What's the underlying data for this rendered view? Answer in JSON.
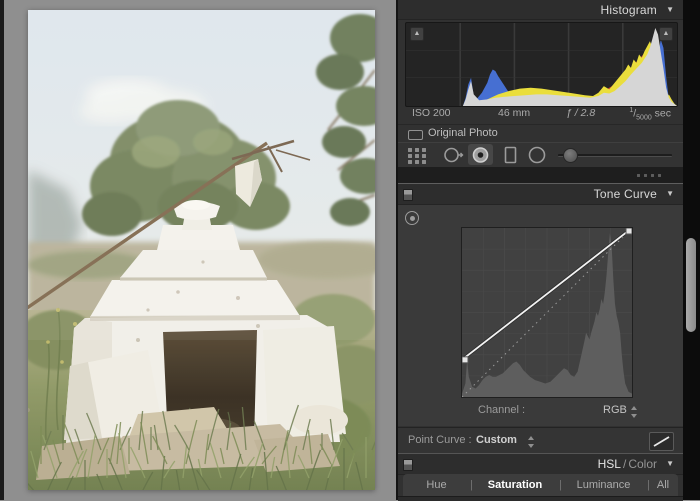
{
  "glyphs": {
    "collapse": "▼",
    "clip_warning": "▲"
  },
  "colors": {
    "hist_gray": "#d6d6d6",
    "hist_blue": "#466fd2",
    "hist_yellow": "#eade3c",
    "hist_red": "#ce4337",
    "hist_green": "#3da64c",
    "hist_magenta": "#bf3fae",
    "curve_silhouette": "#5e5e5e",
    "curve_line": "#f2f2f2",
    "curve_dotted": "#9b9b9b",
    "curve_grid": "#4a4a4a"
  },
  "histogram_panel": {
    "title": "Histogram",
    "meta": {
      "iso": "ISO 200",
      "focal_length": "46 mm",
      "aperture": "ƒ / 2.8",
      "shutter_numerator": "1",
      "shutter_denominator": "5000",
      "shutter_unit": "sec"
    },
    "original_photo_label": "Original Photo",
    "chart": {
      "type": "area",
      "x_range": [
        0,
        255
      ],
      "note_axis": "tonal value 0-100% width, height % of box",
      "series": [
        {
          "name": "magenta",
          "points": [
            [
              25,
              0
            ],
            [
              27,
              8
            ],
            [
              29,
              18
            ],
            [
              31,
              30
            ],
            [
              33,
              26
            ],
            [
              35,
              18
            ],
            [
              37,
              11
            ],
            [
              39,
              7
            ],
            [
              42,
              4
            ],
            [
              45,
              0
            ]
          ]
        },
        {
          "name": "green",
          "points": [
            [
              26,
              0
            ],
            [
              30,
              4
            ],
            [
              34,
              8
            ],
            [
              38,
              12
            ],
            [
              42,
              15
            ],
            [
              46,
              16
            ],
            [
              50,
              16
            ],
            [
              54,
              14
            ],
            [
              58,
              12
            ],
            [
              62,
              10
            ],
            [
              66,
              9
            ],
            [
              70,
              10
            ],
            [
              74,
              16
            ],
            [
              78,
              24
            ],
            [
              81,
              32
            ],
            [
              84,
              40
            ],
            [
              86,
              48
            ],
            [
              88,
              56
            ],
            [
              89,
              62
            ],
            [
              90,
              66
            ],
            [
              91,
              60
            ],
            [
              92,
              48
            ],
            [
              93,
              30
            ],
            [
              94,
              16
            ],
            [
              95,
              8
            ],
            [
              96,
              3
            ],
            [
              97,
              0
            ]
          ]
        },
        {
          "name": "red",
          "points": [
            [
              25,
              0
            ],
            [
              28,
              3
            ],
            [
              32,
              6
            ],
            [
              36,
              9
            ],
            [
              40,
              12
            ],
            [
              45,
              14
            ],
            [
              50,
              14
            ],
            [
              55,
              13
            ],
            [
              60,
              11
            ],
            [
              65,
              9
            ],
            [
              70,
              10
            ],
            [
              73,
              18
            ],
            [
              76,
              24
            ],
            [
              79,
              32
            ],
            [
              82,
              42
            ],
            [
              84,
              50
            ],
            [
              86,
              56
            ],
            [
              88,
              64
            ],
            [
              89,
              70
            ],
            [
              90,
              76
            ],
            [
              91,
              68
            ],
            [
              92,
              56
            ],
            [
              93,
              36
            ],
            [
              94,
              20
            ],
            [
              95,
              10
            ],
            [
              96,
              4
            ],
            [
              97,
              0
            ]
          ]
        },
        {
          "name": "blue",
          "points": [
            [
              21,
              0
            ],
            [
              22,
              10
            ],
            [
              23,
              26
            ],
            [
              24,
              34
            ],
            [
              25,
              12
            ],
            [
              26,
              8
            ],
            [
              28,
              16
            ],
            [
              30,
              28
            ],
            [
              31,
              38
            ],
            [
              32,
              44
            ],
            [
              33,
              42
            ],
            [
              34,
              36
            ],
            [
              36,
              26
            ],
            [
              38,
              16
            ],
            [
              40,
              10
            ],
            [
              43,
              8
            ],
            [
              48,
              7
            ],
            [
              55,
              6
            ],
            [
              62,
              5
            ],
            [
              70,
              6
            ],
            [
              76,
              8
            ],
            [
              80,
              12
            ],
            [
              84,
              16
            ],
            [
              87,
              22
            ],
            [
              89,
              30
            ],
            [
              90,
              40
            ],
            [
              91,
              50
            ],
            [
              92,
              55
            ],
            [
              93,
              60
            ],
            [
              94,
              80
            ],
            [
              95,
              70
            ],
            [
              96,
              35
            ],
            [
              97,
              8
            ],
            [
              98,
              0
            ]
          ]
        },
        {
          "name": "yellow",
          "points": [
            [
              24,
              0
            ],
            [
              26,
              4
            ],
            [
              30,
              8
            ],
            [
              34,
              14
            ],
            [
              38,
              18
            ],
            [
              42,
              21
            ],
            [
              46,
              22
            ],
            [
              50,
              21
            ],
            [
              54,
              19
            ],
            [
              58,
              17
            ],
            [
              62,
              15
            ],
            [
              66,
              13
            ],
            [
              69,
              12
            ],
            [
              71,
              16
            ],
            [
              73,
              24
            ],
            [
              75,
              20
            ],
            [
              77,
              28
            ],
            [
              79,
              36
            ],
            [
              81,
              44
            ],
            [
              82,
              50
            ],
            [
              83,
              46
            ],
            [
              84,
              56
            ],
            [
              85,
              52
            ],
            [
              86,
              62
            ],
            [
              87,
              58
            ],
            [
              88,
              66
            ],
            [
              89,
              72
            ],
            [
              90,
              78
            ],
            [
              91,
              70
            ],
            [
              92,
              58
            ],
            [
              93,
              38
            ],
            [
              94,
              22
            ],
            [
              95,
              12
            ],
            [
              96,
              8
            ],
            [
              97,
              14
            ],
            [
              98,
              8
            ],
            [
              99,
              3
            ],
            [
              100,
              0
            ]
          ]
        },
        {
          "name": "gray",
          "points": [
            [
              0,
              0
            ],
            [
              21,
              0
            ],
            [
              22,
              8
            ],
            [
              23,
              20
            ],
            [
              24,
              30
            ],
            [
              25,
              14
            ],
            [
              27,
              7
            ],
            [
              30,
              8
            ],
            [
              33,
              10
            ],
            [
              36,
              11
            ],
            [
              40,
              12
            ],
            [
              44,
              13
            ],
            [
              48,
              14
            ],
            [
              52,
              14
            ],
            [
              56,
              13
            ],
            [
              60,
              12
            ],
            [
              64,
              11
            ],
            [
              68,
              10
            ],
            [
              71,
              12
            ],
            [
              73,
              16
            ],
            [
              75,
              15
            ],
            [
              77,
              18
            ],
            [
              79,
              24
            ],
            [
              81,
              30
            ],
            [
              83,
              38
            ],
            [
              85,
              45
            ],
            [
              87,
              52
            ],
            [
              89,
              62
            ],
            [
              90,
              70
            ],
            [
              91,
              82
            ],
            [
              92,
              94
            ],
            [
              93,
              86
            ],
            [
              94,
              65
            ],
            [
              95,
              45
            ],
            [
              96,
              22
            ],
            [
              97,
              10
            ],
            [
              98,
              5
            ],
            [
              100,
              0
            ]
          ]
        }
      ]
    }
  },
  "toolstrip": {
    "tools": [
      "crop-overlay",
      "spot-removal",
      "red-eye-correction",
      "graduated-filter",
      "radial-filter"
    ],
    "active_tool": "red-eye-correction",
    "slider_position_pct": 4
  },
  "tone_curve_panel": {
    "title": "Tone Curve",
    "channel_label": "Channel :",
    "channel_value": "RGB",
    "point_curve_label": "Point Curve :",
    "point_curve_value": "Custom",
    "curve": {
      "points_pct": [
        [
          0,
          22
        ],
        [
          100,
          100
        ]
      ],
      "reference_diagonal_pct": [
        [
          0,
          0
        ],
        [
          100,
          100
        ]
      ]
    },
    "histogram_silhouette": [
      [
        0,
        2
      ],
      [
        2,
        8
      ],
      [
        3,
        22
      ],
      [
        4,
        12
      ],
      [
        6,
        6
      ],
      [
        8,
        5
      ],
      [
        10,
        7
      ],
      [
        12,
        10
      ],
      [
        14,
        12
      ],
      [
        16,
        13
      ],
      [
        18,
        12
      ],
      [
        20,
        12
      ],
      [
        22,
        13
      ],
      [
        24,
        14
      ],
      [
        27,
        17
      ],
      [
        30,
        20
      ],
      [
        32,
        21
      ],
      [
        34,
        19
      ],
      [
        36,
        16
      ],
      [
        38,
        14
      ],
      [
        40,
        12
      ],
      [
        43,
        10
      ],
      [
        46,
        9
      ],
      [
        49,
        8
      ],
      [
        52,
        9
      ],
      [
        55,
        12
      ],
      [
        58,
        15
      ],
      [
        60,
        17
      ],
      [
        62,
        16
      ],
      [
        64,
        13
      ],
      [
        66,
        12
      ],
      [
        68,
        15
      ],
      [
        70,
        24
      ],
      [
        72,
        33
      ],
      [
        73,
        38
      ],
      [
        74,
        36
      ],
      [
        75,
        34
      ],
      [
        76,
        38
      ],
      [
        78,
        45
      ],
      [
        79,
        50
      ],
      [
        80,
        48
      ],
      [
        81,
        52
      ],
      [
        82,
        58
      ],
      [
        83,
        55
      ],
      [
        84,
        62
      ],
      [
        85,
        72
      ],
      [
        86,
        85
      ],
      [
        87,
        97
      ],
      [
        88,
        90
      ],
      [
        89,
        70
      ],
      [
        90,
        55
      ],
      [
        91,
        48
      ],
      [
        92,
        44
      ],
      [
        93,
        38
      ],
      [
        94,
        25
      ],
      [
        95,
        15
      ],
      [
        96,
        8
      ],
      [
        98,
        3
      ],
      [
        100,
        2
      ]
    ]
  },
  "hsl_panel": {
    "title_primary": "HSL",
    "title_divider": "/",
    "title_secondary": "Color",
    "tabs": [
      "Hue",
      "Saturation",
      "Luminance",
      "All"
    ],
    "active_tab": "Saturation",
    "tab_divider": "|"
  }
}
